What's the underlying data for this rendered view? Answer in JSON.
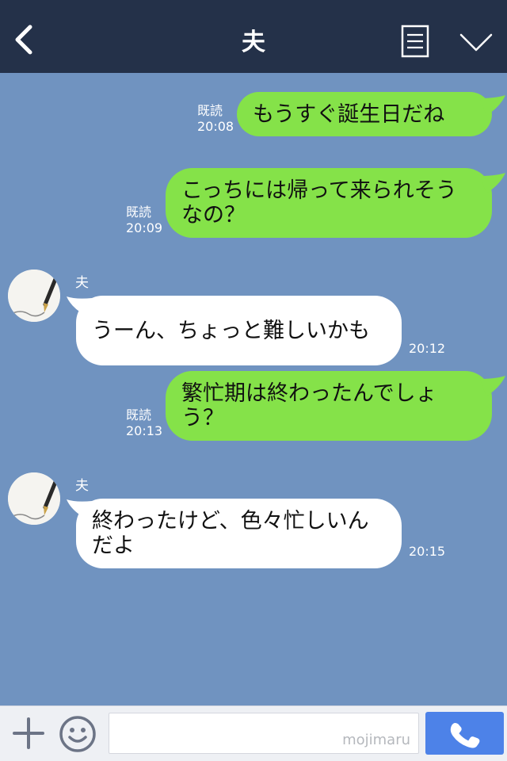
{
  "header": {
    "title": "夫",
    "back_icon": "chevron-left-icon",
    "menu_icon": "note-list-icon",
    "collapse_icon": "chevron-down-icon"
  },
  "colors": {
    "header_bg": "#243149",
    "chat_bg": "#7093c0",
    "outgoing_bubble": "#85e249",
    "incoming_bubble": "#ffffff",
    "call_button": "#4d82e8"
  },
  "messages": [
    {
      "direction": "out",
      "text": "もうすぐ誕生日だね",
      "read": "既読",
      "time": "20:08"
    },
    {
      "direction": "out",
      "text": "こっちには帰って来られそうなの？",
      "read": "既読",
      "time": "20:09"
    },
    {
      "direction": "in",
      "sender": "夫",
      "text": "うーん、ちょっと難しいかも",
      "time": "20:12"
    },
    {
      "direction": "out",
      "text": "繁忙期は終わったんでしょう？",
      "read": "既読",
      "time": "20:13"
    },
    {
      "direction": "in",
      "sender": "夫",
      "text": "終わったけど、色々忙しいんだよ",
      "time": "20:15"
    }
  ],
  "footer": {
    "input_value": "",
    "watermark": "mojimaru",
    "plus_icon": "plus-icon",
    "emoji_icon": "smiley-icon",
    "call_icon": "phone-icon"
  }
}
